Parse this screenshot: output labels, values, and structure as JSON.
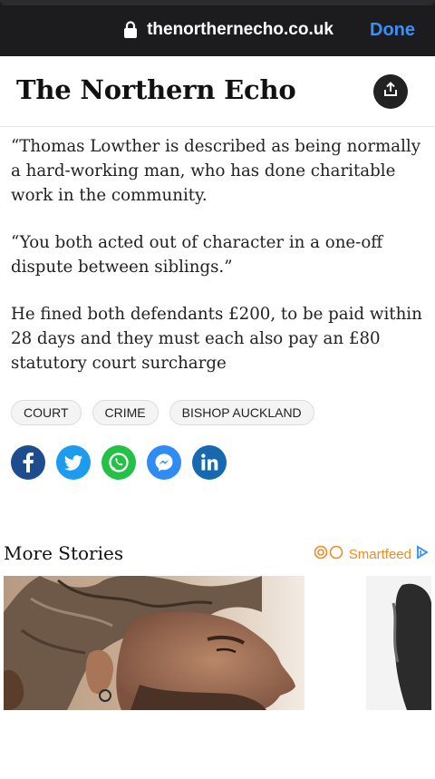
{
  "browser": {
    "url": "thenorthernecho.co.uk",
    "done_label": "Done"
  },
  "masthead": {
    "brand": "The Northern Echo"
  },
  "article": {
    "paragraphs": [
      "“Thomas Lowther is described as being normally a hard-working man, who has done charitable work in the community.",
      "“You both acted out of character in a one-off dispute between siblings.”",
      "He fined both defendants £200, to be paid within 28 days and they must each also pay an £80 statutory court surcharge"
    ]
  },
  "tags": [
    "COURT",
    "CRIME",
    "BISHOP AUCKLAND"
  ],
  "social": {
    "icons": [
      "facebook-icon",
      "twitter-icon",
      "whatsapp-icon",
      "messenger-icon",
      "linkedin-icon"
    ],
    "colors": {
      "facebook": "#1d4c8f",
      "twitter": "#1d9bf0",
      "whatsapp": "#25c146",
      "messenger": "#2f8cf5",
      "linkedin": "#1668b0"
    }
  },
  "more_stories": {
    "title": "More Stories",
    "provider": "Smartfeed",
    "provider_color": "#f08a24"
  }
}
